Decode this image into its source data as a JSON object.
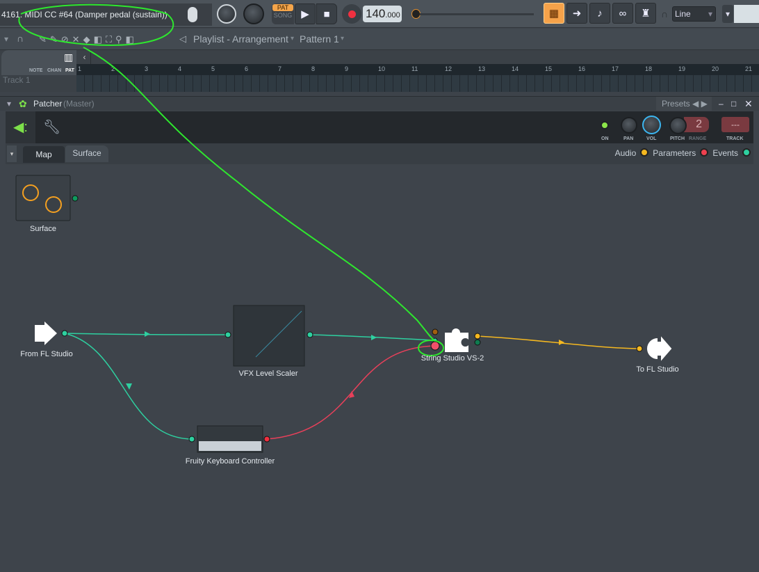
{
  "toolbar": {
    "hint": "4161. MIDI CC #64 (Damper pedal (sustain))",
    "pat_label": "PAT",
    "song_label": "SONG",
    "tempo": "140",
    "tempo_decimals": ".000",
    "snap_mode": "Line",
    "icons": [
      "mouse-icon",
      "master-volume-knob",
      "master-pitch-knob",
      "play-icon",
      "stop-icon",
      "record-icon",
      "piano-roll-icon",
      "arrow-right-icon",
      "wait-input-icon",
      "link-icon",
      "metronome-icon",
      "magnet-icon"
    ]
  },
  "playlist": {
    "title": "Playlist - Arrangement",
    "pattern": "Pattern 1",
    "tool_labels": [
      "NOTE",
      "CHAN",
      "PAT"
    ],
    "track": "Track 1",
    "bars": [
      "1",
      "2",
      "3",
      "4",
      "5",
      "6",
      "7",
      "8",
      "9",
      "10",
      "11",
      "12",
      "13",
      "14",
      "15",
      "16",
      "17",
      "18",
      "19",
      "20",
      "21"
    ]
  },
  "patcher": {
    "title": "Patcher",
    "subtitle": "(Master)",
    "presets": "Presets",
    "controls": {
      "on": "ON",
      "pan": "PAN",
      "vol": "VOL",
      "pitch": "PITCH",
      "range": "RANGE",
      "range_value": "2",
      "track": "TRACK",
      "track_value": "---"
    },
    "tabs": [
      {
        "label": "Map",
        "active": true
      },
      {
        "label": "Surface",
        "active": false
      }
    ],
    "legend": [
      {
        "label": "Audio",
        "color": "#f5b820"
      },
      {
        "label": "Parameters",
        "color": "#f0404f"
      },
      {
        "label": "Events",
        "color": "#2ed0a0"
      }
    ],
    "nodes": {
      "surface": "Surface",
      "from": "From FL Studio",
      "vfx": "VFX Level Scaler",
      "string": "String Studio VS-2",
      "to": "To FL Studio",
      "fkc": "Fruity Keyboard Controller"
    },
    "colors": {
      "events": "#2ed0a0",
      "params": "#e8405a",
      "audio": "#f5b820",
      "accent": "#7de04a"
    }
  }
}
